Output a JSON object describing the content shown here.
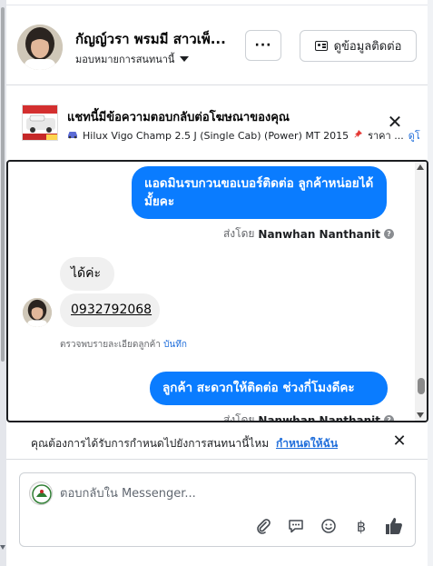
{
  "header": {
    "contact_name": "กัญญ์วรา พรมมี สาวเพ็...",
    "assign_label": "มอบหมายการสนทนานี้",
    "more_label": "···",
    "contact_info_label": "ดูข้อมูลติดต่อ"
  },
  "ad": {
    "title": "แชทนี้มีข้อความตอบกลับต่อโฆษณาของคุณ",
    "subtitle": "Hilux Vigo Champ 2.5 J (Single Cab) (Power) MT 2015",
    "price_fragment": "ราคา ...",
    "view_link": "ดูโ",
    "close_label": "✕"
  },
  "thread": {
    "messages": [
      {
        "direction": "out",
        "text": "แอดมินรบกวนขอเบอร์ติดต่อ ลูกค้าหน่อยได้มั้ยคะ"
      },
      {
        "direction": "in",
        "text": "ได้ค่ะ"
      },
      {
        "direction": "in",
        "text": "0932792068"
      },
      {
        "direction": "out",
        "text": "ลูกค้า  สะดวกให้ติดต่อ ช่วงกี่โมงดีคะ"
      }
    ],
    "sent_by_prefix": "ส่งโดย",
    "sent_by_name": "Nanwhan Nanthanit",
    "details_text": "ตรวจพบรายละเอียดลูกค้า",
    "details_link": "บันทึก"
  },
  "banner": {
    "text": "คุณต้องการได้รับการกำหนดไปยังการสนทนานี้ไหม",
    "link": "กำหนดให้ฉัน",
    "close_label": "✕"
  },
  "composer": {
    "placeholder": "ตอบกลับใน Messenger...",
    "baht_symbol": "฿"
  },
  "colors": {
    "accent": "#0a7cff",
    "link": "#216fdb"
  }
}
